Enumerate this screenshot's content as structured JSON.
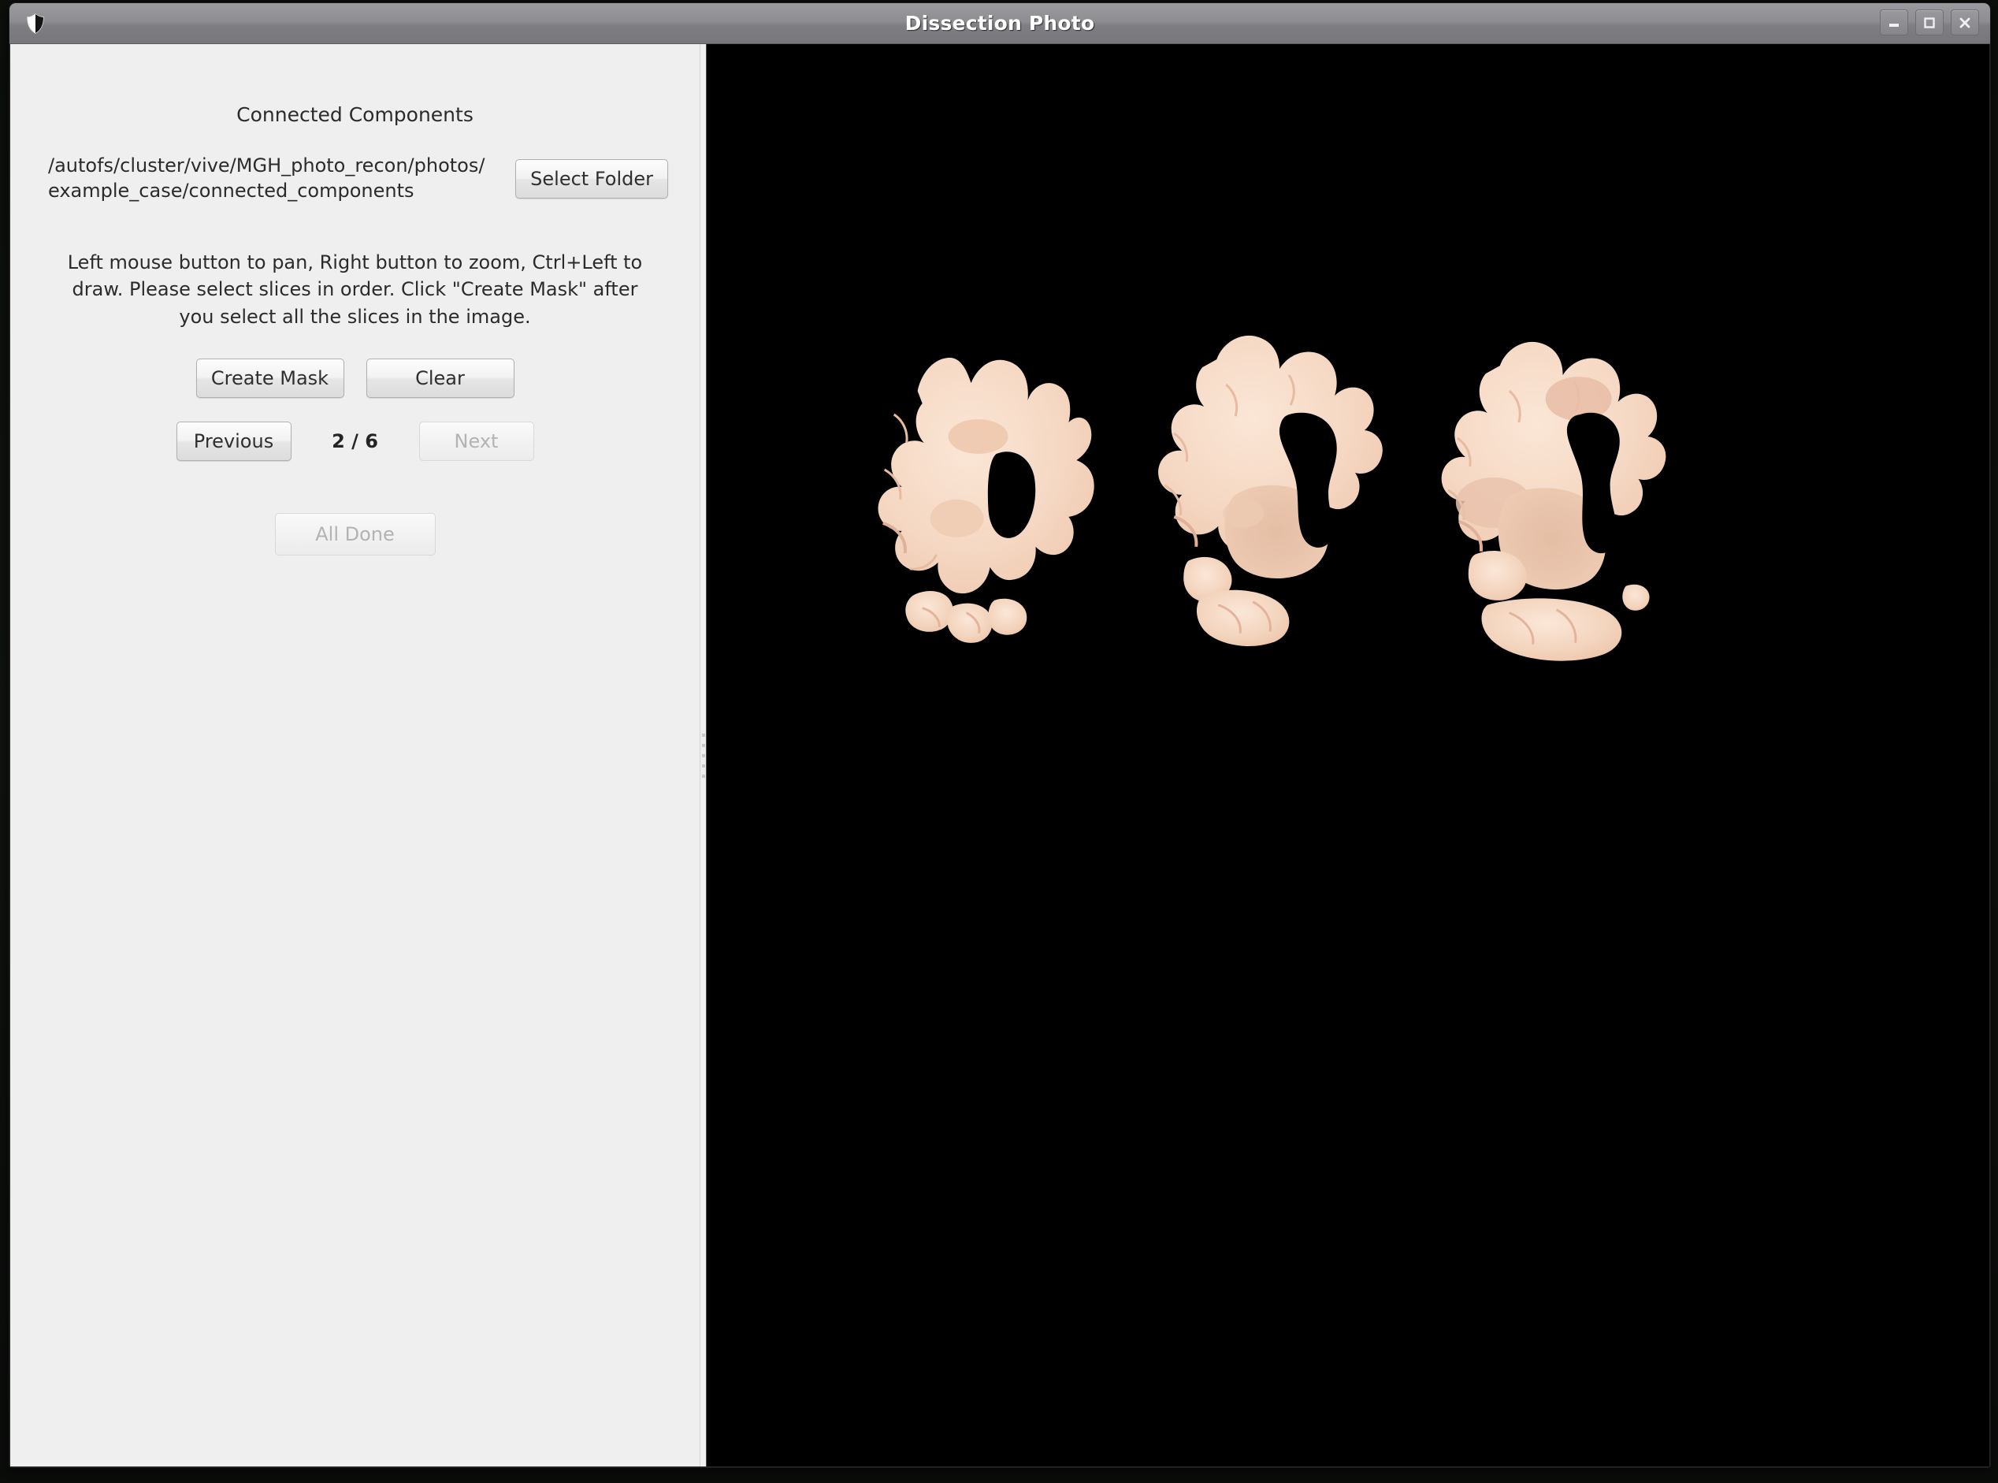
{
  "window": {
    "title": "Dissection Photo",
    "icon": "shield-icon",
    "controls": {
      "minimize": "minimize-icon",
      "maximize": "maximize-icon",
      "close": "close-icon"
    }
  },
  "sidebar": {
    "panel_title": "Connected Components",
    "folder_path_line1": "/autofs/cluster/vive/MGH_photo_recon/photos/",
    "folder_path_line2": "example_case/connected_components",
    "select_folder_label": "Select Folder",
    "instructions": "Left mouse button to pan, Right button to zoom, Ctrl+Left to draw. Please select slices in order. Click \"Create Mask\" after you select all the slices in the image.",
    "create_mask_label": "Create Mask",
    "clear_label": "Clear",
    "previous_label": "Previous",
    "counter": "2 / 6",
    "next_label": "Next",
    "all_done_label": "All Done",
    "states": {
      "create_mask_enabled": true,
      "clear_enabled": true,
      "previous_enabled": true,
      "next_enabled": false,
      "all_done_enabled": false
    }
  },
  "viewer": {
    "background_color": "#000000",
    "slice_count": 3,
    "slice_tissue_color": "#f3d5c0",
    "slice_labels": [
      "brain-slice-1",
      "brain-slice-2",
      "brain-slice-3"
    ]
  },
  "colors": {
    "panel_background": "#efefef",
    "titlebar": "#8d8d92",
    "text": "#2b2b2b",
    "disabled_text": "#b3b3b3",
    "canvas": "#000000"
  }
}
